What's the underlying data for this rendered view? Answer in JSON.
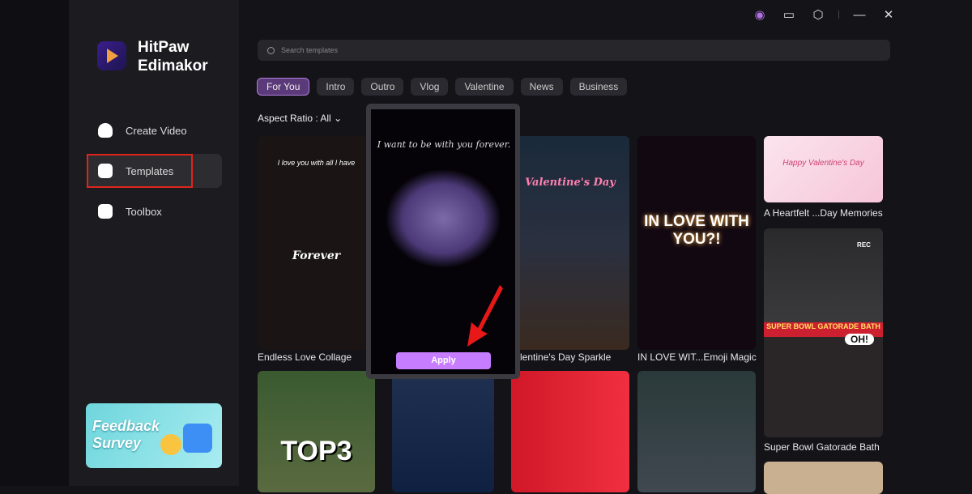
{
  "app": {
    "name_line1": "HitPaw",
    "name_line2": "Edimakor"
  },
  "sidebar": {
    "items": [
      {
        "label": "Create Video"
      },
      {
        "label": "Templates"
      },
      {
        "label": "Toolbox"
      }
    ],
    "banner": {
      "line1": "Feedback",
      "line2": "Survey"
    }
  },
  "topbar": {
    "icons": [
      "account-icon",
      "feedback-icon",
      "settings-icon",
      "minimize-icon",
      "close-icon"
    ]
  },
  "search": {
    "placeholder": "Search templates"
  },
  "tabs": [
    {
      "label": "For You"
    },
    {
      "label": "Intro"
    },
    {
      "label": "Outro"
    },
    {
      "label": "Vlog"
    },
    {
      "label": "Valentine"
    },
    {
      "label": "News"
    },
    {
      "label": "Business"
    }
  ],
  "filter": {
    "label": "Aspect Ratio : All"
  },
  "templates": [
    {
      "title": "Endless Love Collage",
      "overlay": "I love you with all I have",
      "overlay2": "Forever"
    },
    {
      "title": "lentine's Day Sparkle",
      "overlay": "Valentine's Day"
    },
    {
      "title": "IN LOVE WIT...Emoji Magic",
      "overlay": "IN LOVE WITH YOU?!"
    },
    {
      "title": "A Heartfelt ...Day Memories",
      "overlay": "Happy Valentine's Day"
    },
    {
      "title": "Super Bowl Gatorade Bath",
      "overlay": "SUPER BOWL GATORADE BATH",
      "overlay2": "OH!",
      "overlay3": "REC"
    },
    {
      "overlay": "TOP3"
    }
  ],
  "preview": {
    "text": "I want to be with you forever.",
    "apply": "Apply"
  },
  "colors": {
    "accent": "#c77dff",
    "highlight": "#e0241c"
  }
}
